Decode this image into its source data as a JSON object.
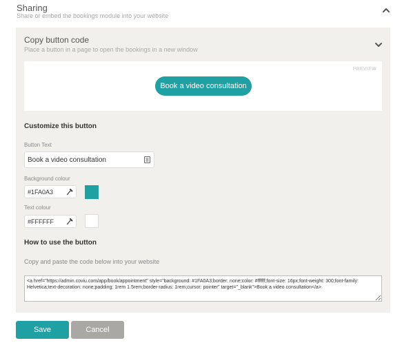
{
  "sharing": {
    "title": "Sharing",
    "subtitle": "Share or embed the bookings module into your website",
    "collapse_icon": "chevron-up-icon"
  },
  "copy_section": {
    "title": "Copy button code",
    "subtitle": "Place a button in a page to open the bookings in a new window",
    "expand_icon": "chevron-down-icon"
  },
  "preview": {
    "label": "PREVIEW",
    "button_label": "Book a video consultation"
  },
  "customize": {
    "heading": "Customize this button",
    "button_text_label": "Button Text",
    "button_text_value": "Book a video consultation",
    "background_label": "Background colour",
    "background_value": "#1FA0A3",
    "text_colour_label": "Text colour",
    "text_colour_value": "#FFFFFF"
  },
  "howto": {
    "heading": "How to use the button",
    "instruction": "Copy and paste the code below into your website",
    "code": "<a href=\"https://admin.coviu.com/app/book/appointment\" style=\"background: #1FA0A3;border: none;color: #ffffff;font-size: 16px;font-weight: 300;font-family: Helvetica;text-decoration: none;padding: 1rem 1.5rem;border-radius: 1rem;cursor: pointer\" target=\"_blank\">Book a video consultation</a>"
  },
  "actions": {
    "save_label": "Save",
    "cancel_label": "Cancel"
  },
  "colors": {
    "accent": "#1FA0A3",
    "panel_bg": "#f1f0ec",
    "cancel_bg": "#a9a8a5"
  }
}
